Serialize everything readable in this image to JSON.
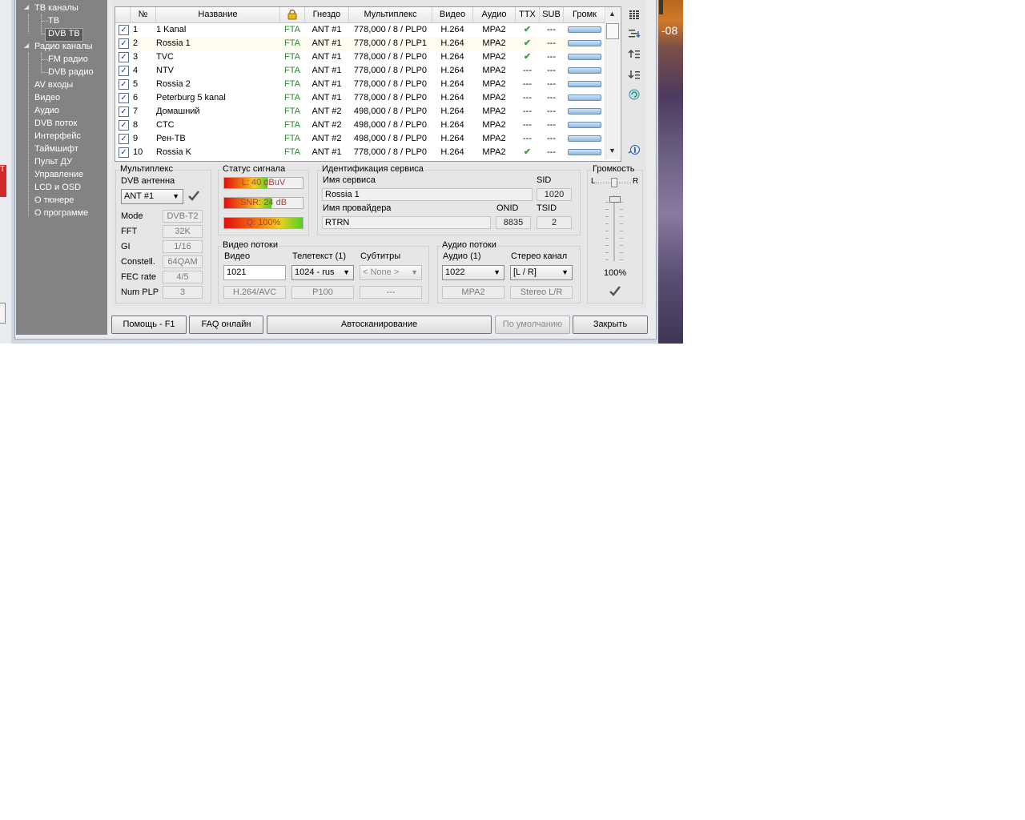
{
  "desktop": {
    "time_fragment": "-08"
  },
  "leftedge": {
    "red_label": "T"
  },
  "tree": {
    "items": [
      {
        "label": "ТВ каналы",
        "expanded": true
      },
      {
        "label": "ТВ"
      },
      {
        "label": "DVB ТВ",
        "selected": true
      },
      {
        "label": "Радио каналы",
        "expanded": true
      },
      {
        "label": "FM радио"
      },
      {
        "label": "DVB радио"
      },
      {
        "label": "AV входы"
      },
      {
        "label": "Видео"
      },
      {
        "label": "Аудио"
      },
      {
        "label": "DVB поток"
      },
      {
        "label": "Интерфейс"
      },
      {
        "label": "Таймшифт"
      },
      {
        "label": "Пульт ДУ"
      },
      {
        "label": "Управление"
      },
      {
        "label": "LCD и OSD"
      },
      {
        "label": "О тюнере"
      },
      {
        "label": "О программе"
      }
    ]
  },
  "table": {
    "headers": [
      "№",
      "Название",
      "lock-icon",
      "Гнездо",
      "Мультиплекс",
      "Видео",
      "Аудио",
      "TTX",
      "SUB",
      "Громк"
    ],
    "rows": [
      {
        "num": "1",
        "name": "1 Kanal",
        "enc": "FTA",
        "socket": "ANT #1",
        "mux": "778,000 / 8 / PLP0",
        "video": "H.264",
        "audio": "MPA2",
        "ttx": "ok",
        "sub": "---"
      },
      {
        "num": "2",
        "name": "Rossia 1",
        "enc": "FTA",
        "socket": "ANT #1",
        "mux": "778,000 / 8 / PLP1",
        "video": "H.264",
        "audio": "MPA2",
        "ttx": "ok",
        "sub": "---"
      },
      {
        "num": "3",
        "name": "TVC",
        "enc": "FTA",
        "socket": "ANT #1",
        "mux": "778,000 / 8 / PLP0",
        "video": "H.264",
        "audio": "MPA2",
        "ttx": "ok",
        "sub": "---"
      },
      {
        "num": "4",
        "name": "NTV",
        "enc": "FTA",
        "socket": "ANT #1",
        "mux": "778,000 / 8 / PLP0",
        "video": "H.264",
        "audio": "MPA2",
        "ttx": "---",
        "sub": "---"
      },
      {
        "num": "5",
        "name": "Rossia 2",
        "enc": "FTA",
        "socket": "ANT #1",
        "mux": "778,000 / 8 / PLP0",
        "video": "H.264",
        "audio": "MPA2",
        "ttx": "---",
        "sub": "---"
      },
      {
        "num": "6",
        "name": "Peterburg 5 kanal",
        "enc": "FTA",
        "socket": "ANT #1",
        "mux": "778,000 / 8 / PLP0",
        "video": "H.264",
        "audio": "MPA2",
        "ttx": "---",
        "sub": "---"
      },
      {
        "num": "7",
        "name": "Домашний",
        "enc": "FTA",
        "socket": "ANT #2",
        "mux": "498,000 / 8 / PLP0",
        "video": "H.264",
        "audio": "MPA2",
        "ttx": "---",
        "sub": "---"
      },
      {
        "num": "8",
        "name": "CTC",
        "enc": "FTA",
        "socket": "ANT #2",
        "mux": "498,000 / 8 / PLP0",
        "video": "H.264",
        "audio": "MPA2",
        "ttx": "---",
        "sub": "---"
      },
      {
        "num": "9",
        "name": "Рен-ТВ",
        "enc": "FTA",
        "socket": "ANT #2",
        "mux": "498,000 / 8 / PLP0",
        "video": "H.264",
        "audio": "MPA2",
        "ttx": "---",
        "sub": "---"
      },
      {
        "num": "10",
        "name": "Rossia K",
        "enc": "FTA",
        "socket": "ANT #1",
        "mux": "778,000 / 8 / PLP0",
        "video": "H.264",
        "audio": "MPA2",
        "ttx": "ok",
        "sub": "---"
      }
    ]
  },
  "multiplex": {
    "title": "Мультиплекс",
    "antenna_label": "DVB антенна",
    "antenna_value": "ANT #1",
    "fields": [
      {
        "label": "Mode",
        "value": "DVB-T2"
      },
      {
        "label": "FFT",
        "value": "32K"
      },
      {
        "label": "GI",
        "value": "1/16"
      },
      {
        "label": "Constell.",
        "value": "64QAM"
      },
      {
        "label": "FEC rate",
        "value": "4/5"
      },
      {
        "label": "Num PLP",
        "value": "3"
      }
    ]
  },
  "signal": {
    "title": "Статус сигнала",
    "level": {
      "text": "L: 40 dBuV",
      "fill": 0.55
    },
    "snr": {
      "text": "SNR: 24 dB",
      "fill": 0.6
    },
    "quality": {
      "text": "Q: 100%",
      "fill": 1.0
    }
  },
  "service": {
    "title": "Идентификация сервиса",
    "name_label": "Имя сервиса",
    "name_value": "Rossia 1",
    "sid_label": "SID",
    "sid_value": "1020",
    "provider_label": "Имя провайдера",
    "provider_value": "RTRN",
    "onid_label": "ONID",
    "onid_value": "8835",
    "tsid_label": "TSID",
    "tsid_value": "2"
  },
  "video_streams": {
    "title": "Видео потоки",
    "video_label": "Видео",
    "video_value": "1021",
    "video_codec": "H.264/AVC",
    "teletext_label": "Телетекст (1)",
    "teletext_value": "1024 - rus",
    "teletext_page": "P100",
    "subtitles_label": "Субтитры",
    "subtitles_value": "< None >",
    "subtitles_info": "---"
  },
  "audio_streams": {
    "title": "Аудио потоки",
    "audio_label": "Аудио (1)",
    "audio_value": "1022",
    "audio_codec": "MPA2",
    "stereo_label": "Стерео канал",
    "stereo_value": "[L / R]",
    "stereo_info": "Stereo L/R"
  },
  "volume": {
    "title": "Громкость",
    "left": "L",
    "right": "R",
    "value": "100%"
  },
  "buttons": {
    "help": "Помощь - F1",
    "faq": "FAQ онлайн",
    "autoscan": "Автосканирование",
    "defaults": "По умолчанию",
    "close": "Закрыть"
  },
  "colors": {
    "tree_bg": "#838383",
    "fta": "#2a8a2a",
    "check_ok": "#3aa040"
  }
}
